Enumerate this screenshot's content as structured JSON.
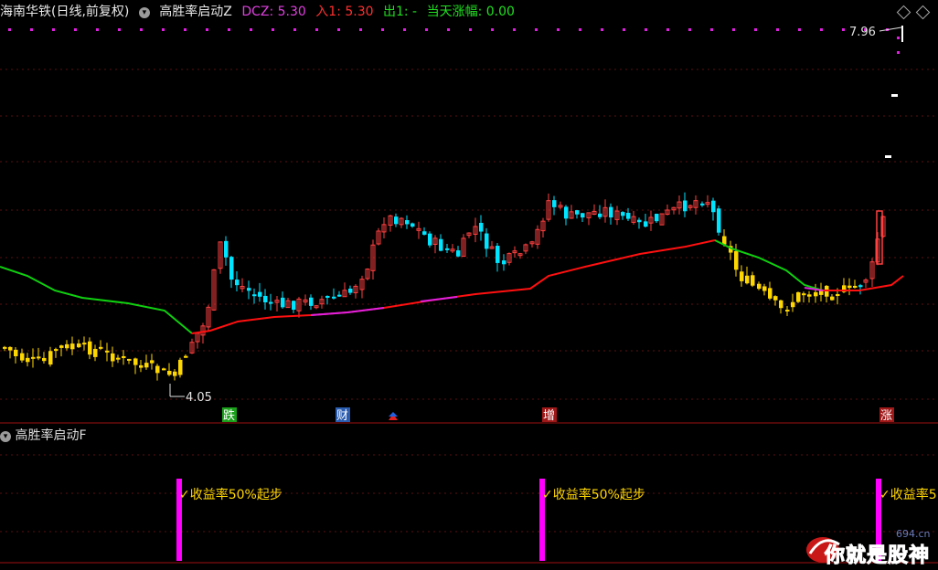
{
  "header": {
    "stock": "海南华铁",
    "mode": "(日线,前复权)",
    "indicator": "高胜率启动Z",
    "dcz_label": "DCZ: 5.30",
    "in1_label": "入1: 5.30",
    "out1_label": "出1: -",
    "change_label": "当天涨幅: 0.00",
    "circle_glyph": "▾"
  },
  "price": {
    "high_label": "7.96",
    "low_label": "4.05"
  },
  "markers": [
    {
      "label": "跌",
      "color": "#1aa01a"
    },
    {
      "label": "财",
      "color": "#2a5db0"
    },
    {
      "label": "增",
      "color": "#a01818"
    },
    {
      "label": "涨",
      "color": "#a01818"
    }
  ],
  "sub": {
    "title": "高胜率启动F",
    "signals": [
      "✓收益率50%起步",
      "✓收益率50%起步",
      "✓收益率5"
    ]
  },
  "watermark": {
    "site": "694.cn",
    "text": "你就是股神"
  },
  "colors": {
    "bull": "#ff4040",
    "bear": "#00e5ff",
    "gold": "#ffd700",
    "line_green": "#10d010",
    "line_red": "#ff1010",
    "line_magenta": "#e020e0",
    "bar": "#ff00ff"
  }
}
